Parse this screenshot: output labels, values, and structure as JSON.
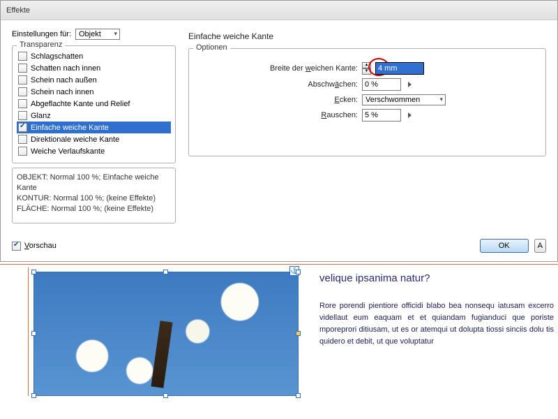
{
  "titlebar": "Effekte",
  "settings_label": "Einstellungen für:",
  "settings_value": "Objekt",
  "left": {
    "group_title": "Transparenz",
    "items": [
      {
        "label": "Schlagschatten",
        "checked": false,
        "selected": false
      },
      {
        "label": "Schatten nach innen",
        "checked": false,
        "selected": false
      },
      {
        "label": "Schein nach außen",
        "checked": false,
        "selected": false
      },
      {
        "label": "Schein nach innen",
        "checked": false,
        "selected": false
      },
      {
        "label": "Abgeflachte Kante und Relief",
        "checked": false,
        "selected": false
      },
      {
        "label": "Glanz",
        "checked": false,
        "selected": false
      },
      {
        "label": "Einfache weiche Kante",
        "checked": true,
        "selected": true
      },
      {
        "label": "Direktionale weiche Kante",
        "checked": false,
        "selected": false
      },
      {
        "label": "Weiche Verlaufskante",
        "checked": false,
        "selected": false
      }
    ],
    "summary": [
      "OBJEKT: Normal 100 %; Einfache weiche Kante",
      "KONTUR: Normal 100 %; (keine Effekte)",
      "FLÄCHE: Normal 100 %; (keine Effekte)"
    ]
  },
  "right": {
    "title": "Einfache weiche Kante",
    "group_title": "Optionen",
    "rows": {
      "width_label": "Breite der weichen Kante:",
      "width_value": "4 mm",
      "soften_label": "Abschwächen:",
      "soften_value": "0 %",
      "corners_label": "Ecken:",
      "corners_value": "Verschwommen",
      "noise_label": "Rauschen:",
      "noise_value": "5 %"
    }
  },
  "bottom": {
    "preview_label": "Vorschau",
    "ok": "OK",
    "cancel_initial": "A"
  },
  "doc": {
    "heading": "velique ipsanima natur?",
    "body": "Rore porendi pientiore officidi blabo bea nonsequ iatusam excerro videllaut eum eaquam et et quiandam fugianduci que poriste mporeprori ditiusam, ut es or atemqui ut dolupta tiossi sinciis dolu tis quidero et debit, ut que voluptatur"
  }
}
